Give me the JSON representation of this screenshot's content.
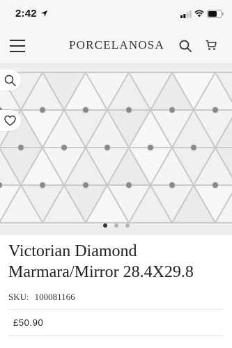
{
  "status_bar": {
    "time": "2:42"
  },
  "header": {
    "brand": "PORCELANOSA",
    "icons": [
      "menu-icon",
      "search-icon",
      "cart-icon"
    ]
  },
  "gallery": {
    "icons": [
      "zoom-icon",
      "heart-icon"
    ],
    "slide_count": 3,
    "active_slide": 1
  },
  "product": {
    "title_line1": "Victorian Diamond",
    "title_line2": "Marmara/Mirror 28.4X29.8",
    "sku_label": "SKU:",
    "sku_value": "100081166",
    "price": "£50.90"
  },
  "colors": {
    "bar_background": "#f6f6f6",
    "gallery_background": "#eeeeee",
    "marble": "#f4f4f4",
    "grout": "#c9c9c9",
    "mirror_dot": "#8a8a8a",
    "active_dot": "#333333",
    "inactive_dot": "#b5b5b5"
  }
}
